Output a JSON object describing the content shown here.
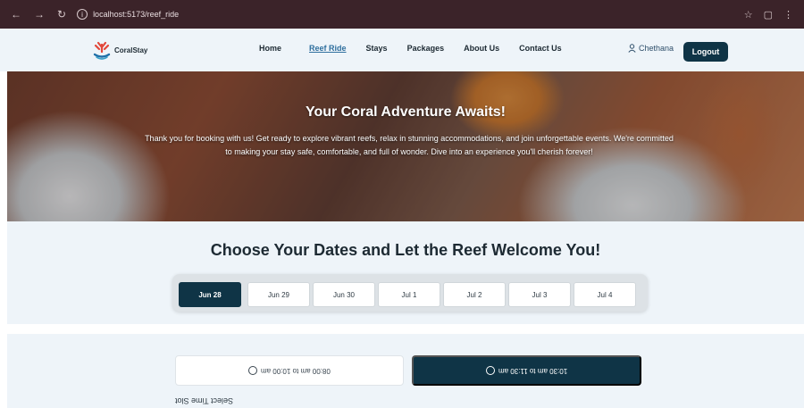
{
  "browser": {
    "url": "localhost:5173/reef_ride",
    "back_icon": "arrow-left-icon",
    "forward_icon": "arrow-right-icon",
    "reload_icon": "reload-icon"
  },
  "brand": {
    "name": "CoralStay"
  },
  "nav": {
    "items": [
      "Home",
      "Reef Ride",
      "Stays",
      "Packages",
      "About Us",
      "Contact Us"
    ],
    "active": "Reef Ride"
  },
  "user": {
    "name": "Chethana",
    "logout_label": "Logout"
  },
  "hero": {
    "title": "Your Coral Adventure Awaits!",
    "text": "Thank you for booking with us! Get ready to explore vibrant reefs, relax in stunning accommodations, and join unforgettable events. We're committed to making your stay safe, comfortable, and full of wonder. Dive into an experience you'll cherish forever!"
  },
  "dates": {
    "heading": "Choose Your Dates and Let the Reef Welcome You!",
    "items": [
      "Jun 28",
      "Jun 29",
      "Jun 30",
      "Jul 1",
      "Jul 2",
      "Jul 3",
      "Jul 4"
    ],
    "selected": "Jun 28"
  },
  "slots": {
    "label": "Select Time Slot",
    "items": [
      "08:00 am to 10:00 am",
      "10:30 am to 11:30 am"
    ],
    "selected": "10:30 am to 11:30 am"
  },
  "colors": {
    "primary": "#0f3446",
    "active_link": "#2f6f9e",
    "section_bg": "#eef4f9"
  }
}
